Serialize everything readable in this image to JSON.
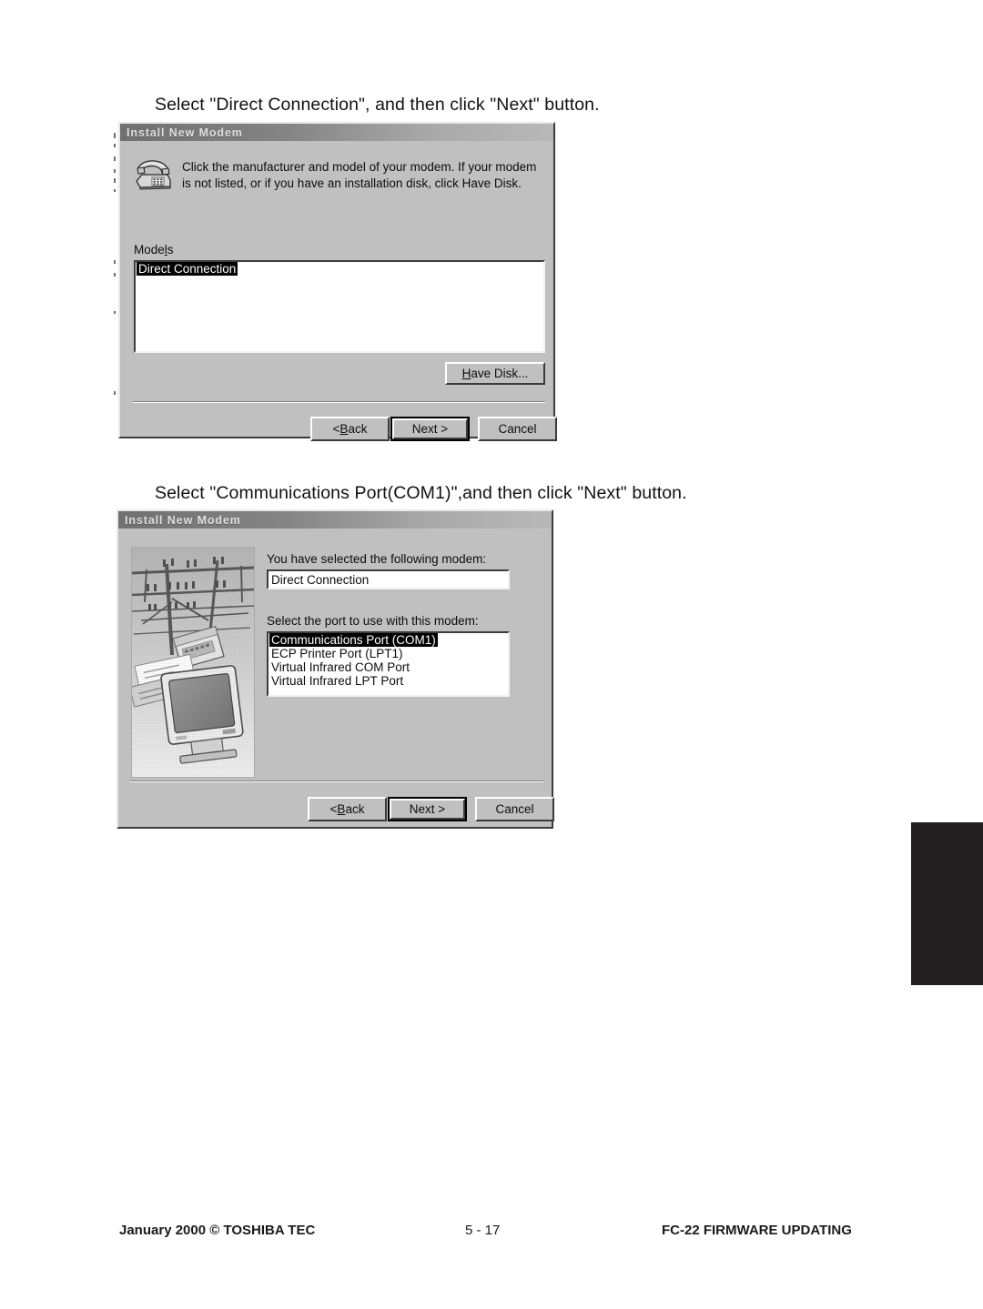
{
  "page": {
    "instruction_1": "Select \"Direct Connection\", and then click \"Next\" button.",
    "instruction_2": "Select \"Communications Port(COM1)\",and then click \"Next\" button."
  },
  "dialog_1": {
    "title": "Install New Modem",
    "icon": "modem-phone-icon",
    "prompt": "Click the manufacturer and model of your modem. If your modem is not listed, or if you have an installation disk, click Have Disk.",
    "models_label_pre": "Mode",
    "models_label_accel": "l",
    "models_label_post": "s",
    "models": [
      {
        "label": "Direct Connection",
        "selected": true
      }
    ],
    "buttons": {
      "have_disk_accel": "H",
      "have_disk_rest": "ave Disk...",
      "back_pre": "< ",
      "back_accel": "B",
      "back_rest": "ack",
      "next": "Next >",
      "cancel": "Cancel"
    }
  },
  "dialog_2": {
    "title": "Install New Modem",
    "photo_alt": "telephone-poles-modem-monitor-photo",
    "selected_modem_label": "You have selected the following modem:",
    "selected_modem_value": "Direct Connection",
    "select_port_label": "Select the port to use with this modem:",
    "ports": [
      {
        "label": "Communications Port (COM1)",
        "selected": true
      },
      {
        "label": "ECP Printer Port (LPT1)",
        "selected": false
      },
      {
        "label": "Virtual Infrared COM Port",
        "selected": false
      },
      {
        "label": "Virtual Infrared LPT Port",
        "selected": false
      }
    ],
    "buttons": {
      "back_pre": "< ",
      "back_accel": "B",
      "back_rest": "ack",
      "next": "Next >",
      "cancel": "Cancel"
    }
  },
  "footer": {
    "left": "January 2000  ©  TOSHIBA TEC",
    "center": "5 - 17",
    "right": "FC-22  FIRMWARE UPDATING"
  },
  "colors": {
    "dialog_face": "#c0c0c0",
    "titlebar_dark": "#707070",
    "titlebar_light": "#b8b8b8",
    "selection": "#000000",
    "tab_black": "#231f20"
  }
}
